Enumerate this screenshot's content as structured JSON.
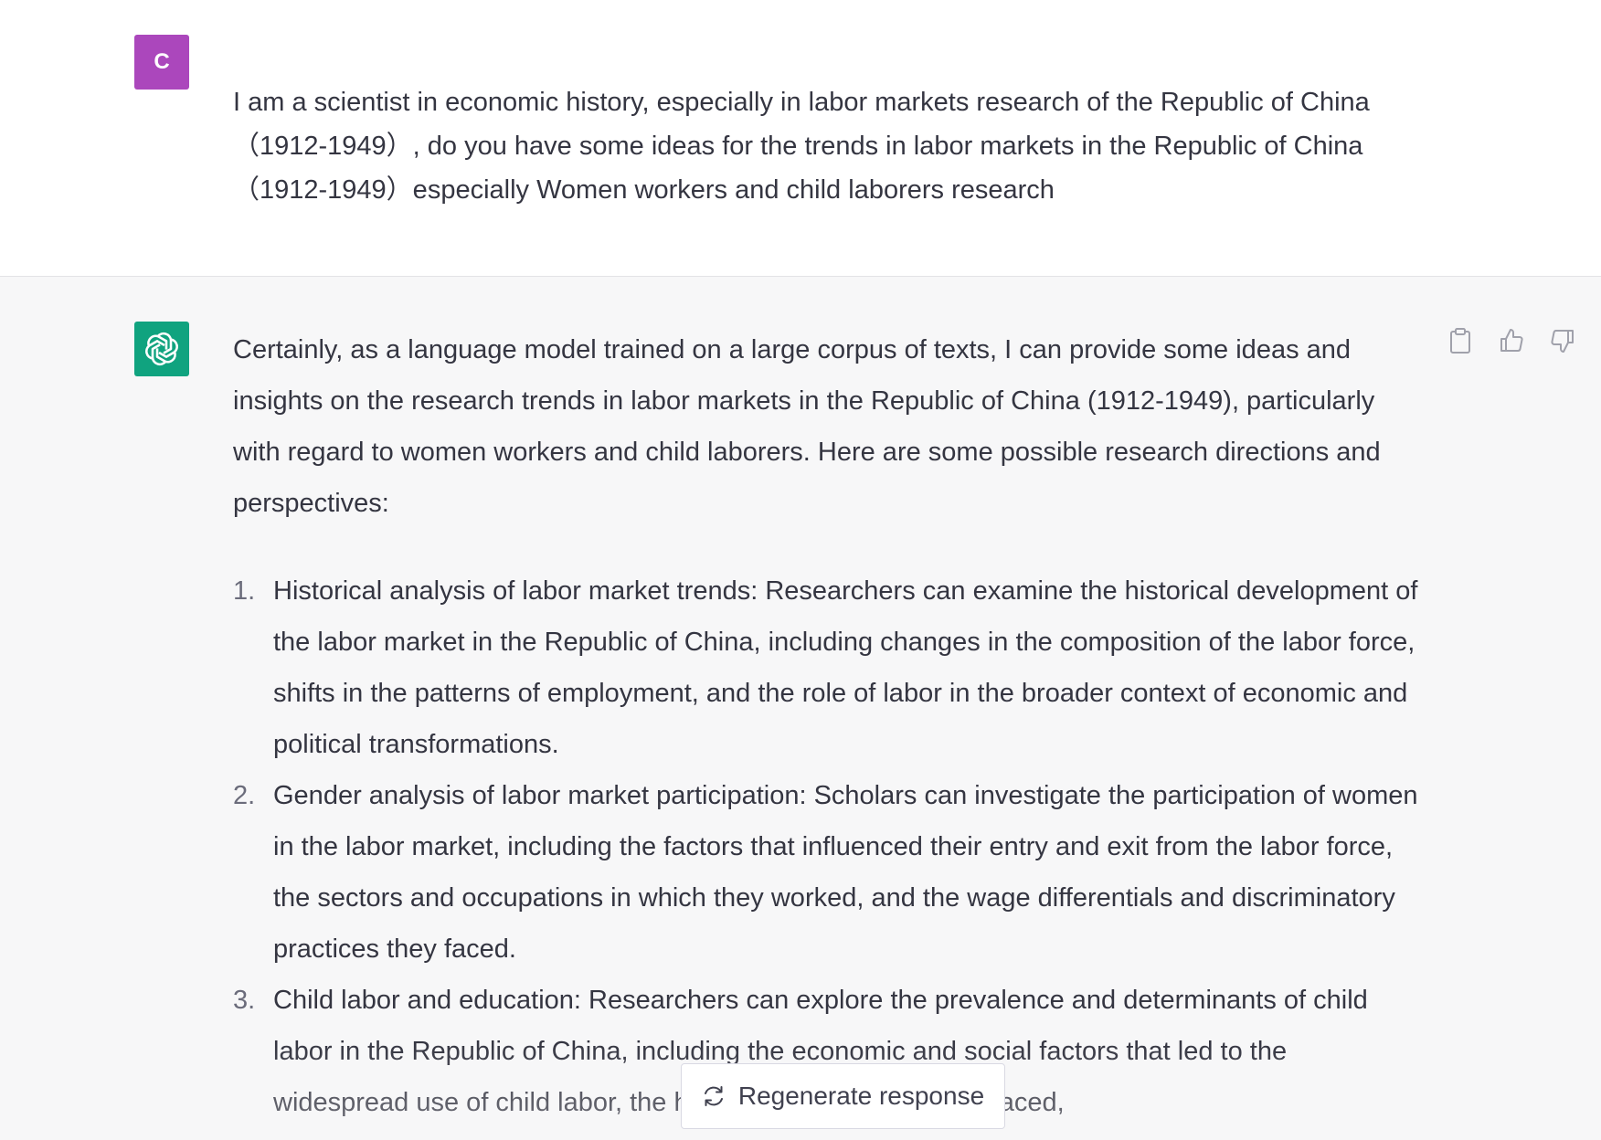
{
  "user_message": {
    "avatar_initial": "C",
    "avatar_color": "#ab47bc",
    "text": "I am a scientist in economic history, especially in labor markets research of  the Republic of China（1912-1949）, do you have some ideas for the trends in labor markets in the Republic of China（1912-1949）especially Women workers and child laborers research"
  },
  "assistant_message": {
    "avatar_icon": "openai-logo-icon",
    "avatar_color": "#10a37f",
    "intro": "Certainly, as a language model trained on a large corpus of texts, I can provide some ideas and insights on the research trends in labor markets in the Republic of China (1912-1949), particularly with regard to women workers and child laborers. Here are some possible research directions and perspectives:",
    "items": [
      {
        "number": "1.",
        "text": "Historical analysis of labor market trends: Researchers can examine the historical development of the labor market in the Republic of China, including changes in the composition of the labor force, shifts in the patterns of employment, and the role of labor in the broader context of economic and political transformations."
      },
      {
        "number": "2.",
        "text": "Gender analysis of labor market participation: Scholars can investigate the participation of women in the labor market, including the factors that influenced their entry and exit from the labor force, the sectors and occupations in which they worked, and the wage differentials and discriminatory practices they faced."
      },
      {
        "number": "3.",
        "text": "Child labor and education: Researchers can explore the prevalence and determinants of child labor in the Republic of China, including the economic and social factors that led to the widespread use of child labor, the hazards that child laborers faced,"
      }
    ],
    "actions": [
      "clipboard-icon",
      "thumbs-up-icon",
      "thumbs-down-icon"
    ]
  },
  "regenerate_button": {
    "icon": "refresh-icon",
    "label": "Regenerate response"
  }
}
